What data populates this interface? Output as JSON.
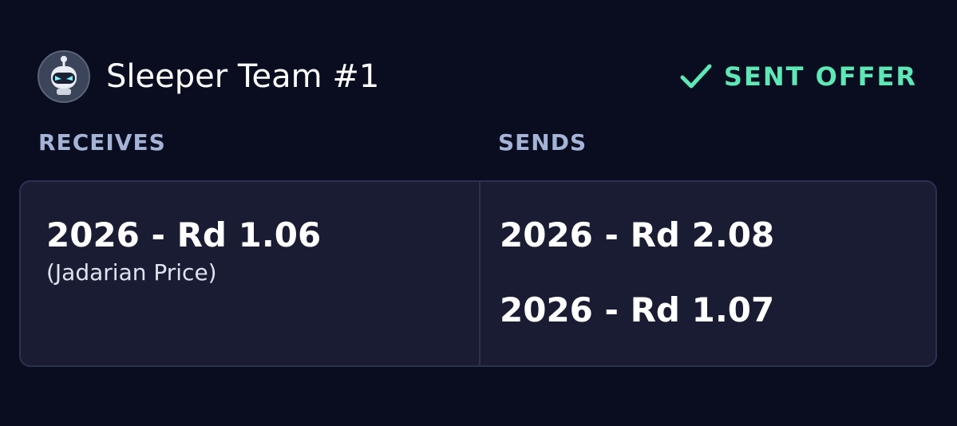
{
  "header": {
    "team_name": "Sleeper Team #1",
    "avatar_icon": "robot-mascot-avatar",
    "status": {
      "icon": "checkmark-icon",
      "label": "SENT OFFER",
      "color": "#5de8b6"
    }
  },
  "columns": {
    "receives_label": "RECEIVES",
    "sends_label": "SENDS"
  },
  "receives": [
    {
      "pick": "2026 - Rd 1.06",
      "detail": "(Jadarian Price)"
    }
  ],
  "sends": [
    {
      "pick": "2026 - Rd 2.08"
    },
    {
      "pick": "2026 - Rd 1.07"
    }
  ],
  "colors": {
    "background": "#090d1f",
    "card": "#1a1c33",
    "label": "#a4b3d6",
    "accent": "#5de8b6"
  }
}
